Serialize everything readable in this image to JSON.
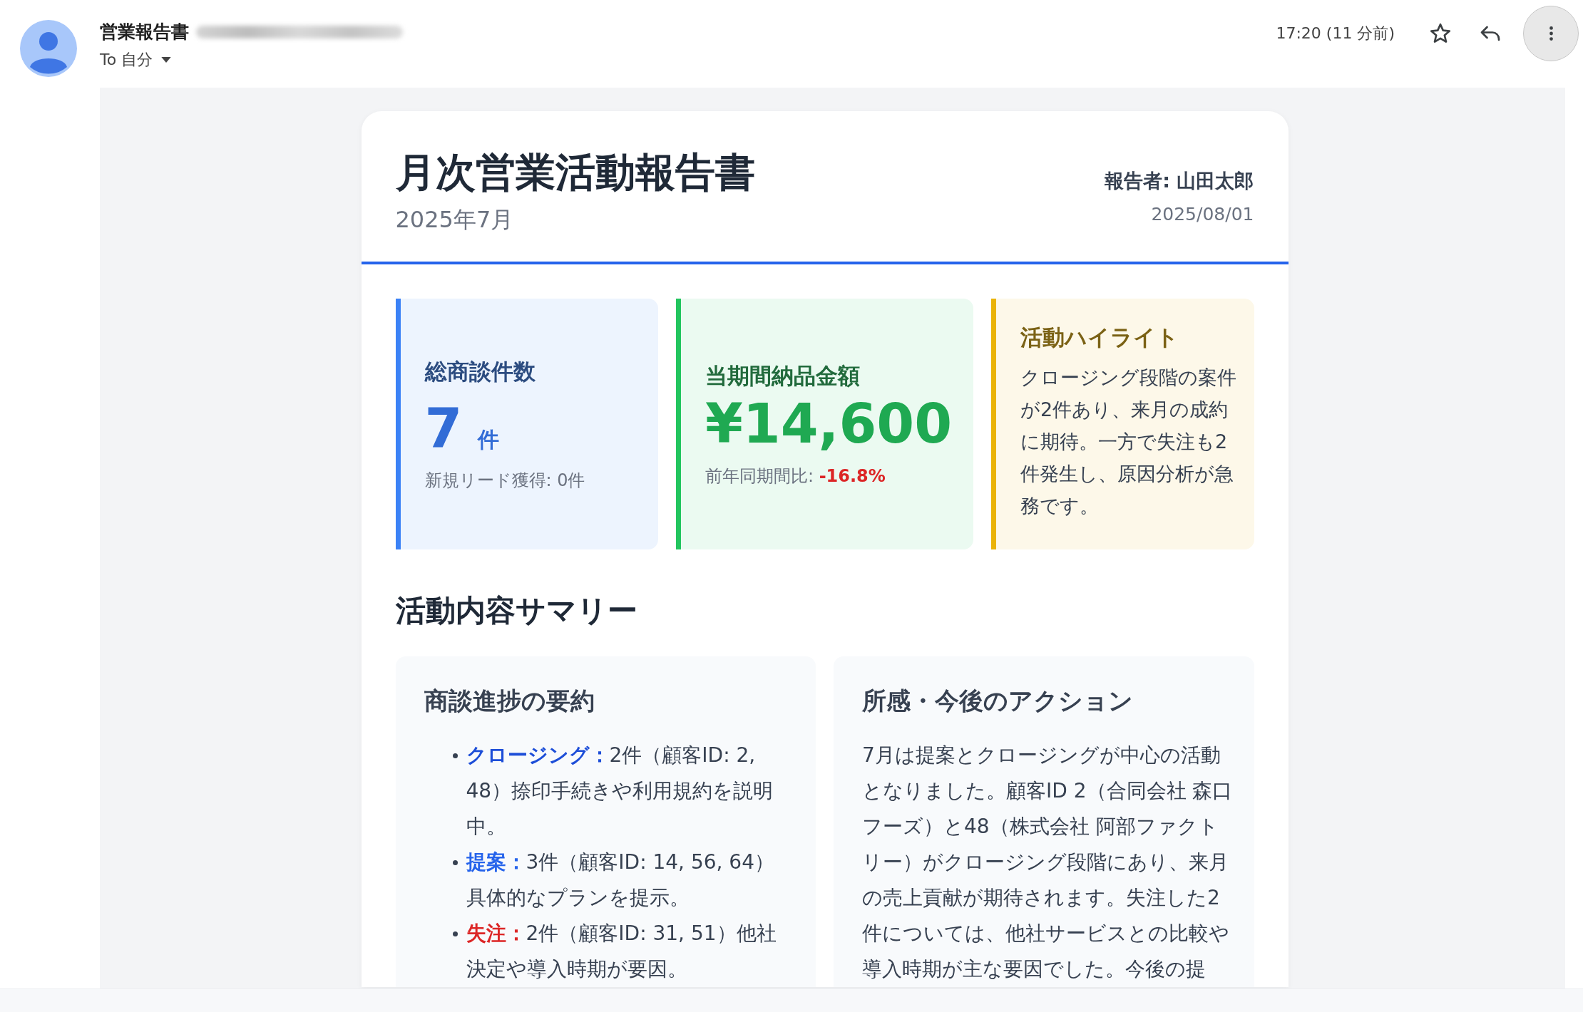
{
  "email_header": {
    "sender_name": "営業報告書",
    "recipient_label": "To 自分",
    "time": "17:20 (11 分前)"
  },
  "report": {
    "title": "月次営業活動報告書",
    "period": "2025年7月",
    "reporter": "報告者: 山田太郎",
    "date": "2025/08/01",
    "metrics": [
      {
        "kind": "count",
        "color": "#3b82f6",
        "title": "総商談件数",
        "value": "7",
        "unit": "件",
        "note": "新規リード獲得: 0件"
      },
      {
        "kind": "amount",
        "color": "#22c55e",
        "title": "当期間納品金額",
        "value": "¥14,600",
        "note": "前年同期間比: ",
        "change": "-16.8%"
      },
      {
        "kind": "text",
        "color": "#eab308",
        "title": "活動ハイライト",
        "body": "クロージング段階の案件が2件あり、来月の成約に期待。一方で失注も2件発生し、原因分析が急務です。"
      }
    ],
    "summary_title": "活動内容サマリー",
    "panels": [
      {
        "kind": "list",
        "title": "商談進捗の要約",
        "items": [
          {
            "label": "クロージング：",
            "color": "#1d4ed8",
            "text": "2件（顧客ID: 2, 48）捺印手続きや利用規約を説明中。"
          },
          {
            "label": "提案：",
            "color": "#2563eb",
            "text": "3件（顧客ID: 14, 56, 64）具体的なプランを提示。"
          },
          {
            "label": "失注：",
            "color": "#dc2626",
            "text": "2件（顧客ID: 31, 51）他社決定や導入時期が要因。"
          }
        ]
      },
      {
        "kind": "paragraph",
        "title": "所感・今後のアクション",
        "body": "7月は提案とクロージングが中心の活動となりました。顧客ID 2（合同会社 森口フーズ）と48（株式会社 阿部ファクトリー）がクロージング段階にあり、来月の売上貢献が期待されます。失注した2件については、他社サービスとの比較や導入時期が主な要因でした。今後の提"
      }
    ]
  }
}
